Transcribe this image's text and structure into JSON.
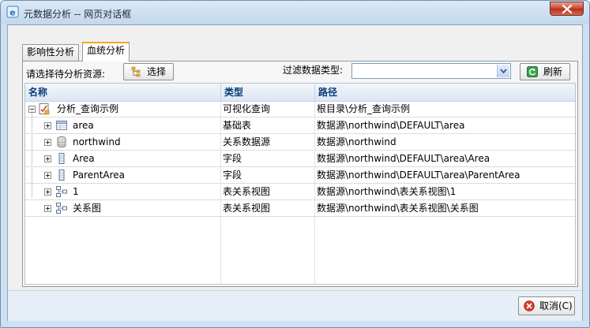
{
  "window": {
    "title": "元数据分析 -- 网页对话框"
  },
  "tabs": [
    {
      "label": "影响性分析"
    },
    {
      "label": "血统分析"
    }
  ],
  "toolbar": {
    "resource_label": "请选择待分析资源:",
    "select_button": "选择",
    "filter_label": "过滤数据类型:",
    "filter_value": "",
    "refresh_button": "刷新"
  },
  "grid": {
    "headers": [
      "名称",
      "类型",
      "路径"
    ],
    "rows": [
      {
        "name": "分析_查询示例",
        "type": "可视化查询",
        "path": "根目录\\分析_查询示例",
        "icon": "query-icon"
      },
      {
        "name": "area",
        "type": "基础表",
        "path": "数据源\\northwind\\DEFAULT\\area",
        "icon": "table-icon"
      },
      {
        "name": "northwind",
        "type": "关系数据源",
        "path": "数据源\\northwind",
        "icon": "database-icon"
      },
      {
        "name": "Area",
        "type": "字段",
        "path": "数据源\\northwind\\DEFAULT\\area\\Area",
        "icon": "field-icon"
      },
      {
        "name": "ParentArea",
        "type": "字段",
        "path": "数据源\\northwind\\DEFAULT\\area\\ParentArea",
        "icon": "field-icon"
      },
      {
        "name": "1",
        "type": "表关系视图",
        "path": "数据源\\northwind\\表关系视图\\1",
        "icon": "relation-view-icon"
      },
      {
        "name": "关系图",
        "type": "表关系视图",
        "path": "数据源\\northwind\\表关系视图\\关系图",
        "icon": "relation-view-icon"
      }
    ]
  },
  "footer": {
    "cancel_button": "取消(C)"
  },
  "colors": {
    "title_bar": "#c3d7ee",
    "close_button": "#c8452f",
    "header_text": "#0b3b78",
    "active_tab_accent": "#f5a623"
  }
}
